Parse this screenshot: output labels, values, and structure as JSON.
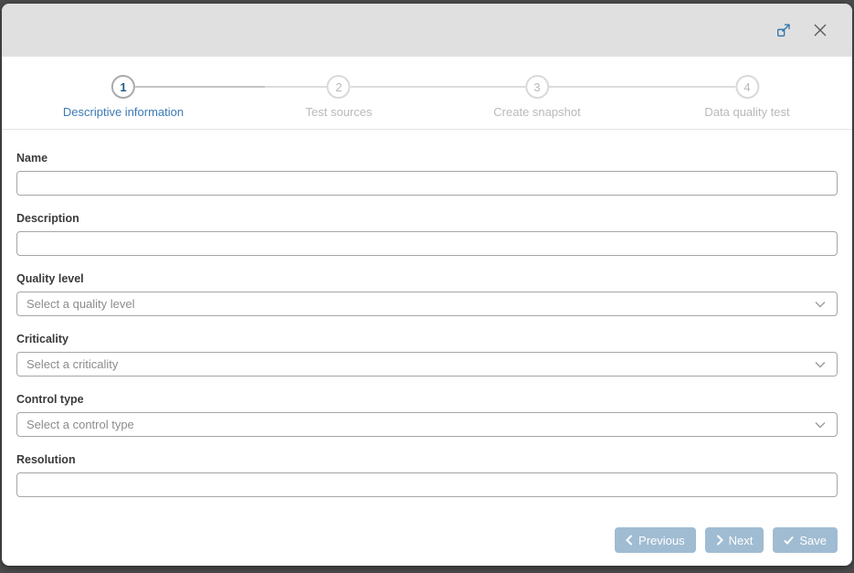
{
  "window": {
    "titlebar": {
      "maximize_icon": "maximize-icon",
      "close_icon": "close-icon"
    }
  },
  "stepper": {
    "steps": [
      {
        "number": "1",
        "label": "Descriptive information",
        "active": true
      },
      {
        "number": "2",
        "label": "Test sources",
        "active": false
      },
      {
        "number": "3",
        "label": "Create snapshot",
        "active": false
      },
      {
        "number": "4",
        "label": "Data quality test",
        "active": false
      }
    ]
  },
  "form": {
    "fields": [
      {
        "label": "Name",
        "type": "text",
        "value": ""
      },
      {
        "label": "Description",
        "type": "text",
        "value": ""
      },
      {
        "label": "Quality level",
        "type": "select",
        "placeholder": "Select a quality level"
      },
      {
        "label": "Criticality",
        "type": "select",
        "placeholder": "Select a criticality"
      },
      {
        "label": "Control type",
        "type": "select",
        "placeholder": "Select a control type"
      },
      {
        "label": "Resolution",
        "type": "text",
        "value": ""
      }
    ]
  },
  "footer": {
    "previous_label": "Previous",
    "next_label": "Next",
    "save_label": "Save"
  },
  "icons": {
    "titlebar": [
      "maximize-icon",
      "close-icon"
    ],
    "selects": "chevron-down-icon",
    "previous_button": "chevron-left-icon",
    "next_button": "chevron-right-icon",
    "save_button": "check-icon"
  },
  "colors": {
    "accent_blue": "#3d7ab5",
    "step_number_blue": "#1f5b87",
    "button_bg": "#a0bcd2",
    "titlebar_bg": "#e0e0e0",
    "backdrop": "#4b4b4b",
    "inactive_gray": "#b9b9b9"
  }
}
